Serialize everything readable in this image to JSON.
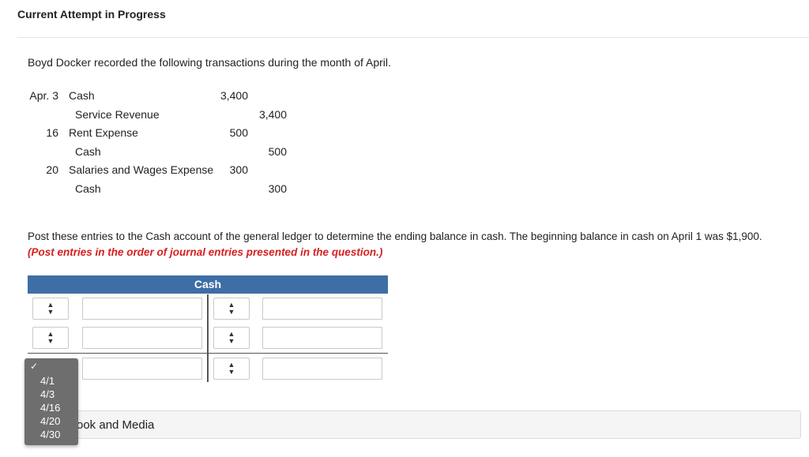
{
  "header": {
    "title": "Current Attempt in Progress"
  },
  "question": {
    "intro": "Boyd Docker recorded the following transactions during the month of April.",
    "journal": [
      {
        "date": "Apr. 3",
        "account": "Cash",
        "debit": "3,400",
        "credit": ""
      },
      {
        "date": "",
        "account": "Service Revenue",
        "debit": "",
        "credit": "3,400"
      },
      {
        "date": "16",
        "account": "Rent Expense",
        "debit": "500",
        "credit": ""
      },
      {
        "date": "",
        "account": "Cash",
        "debit": "",
        "credit": "500"
      },
      {
        "date": "20",
        "account": "Salaries and Wages Expense",
        "debit": "300",
        "credit": ""
      },
      {
        "date": "",
        "account": "Cash",
        "debit": "",
        "credit": "300"
      }
    ],
    "instruction": "Post these entries to the Cash account of the general ledger to determine the ending balance in cash. The beginning balance in cash on April 1 was $1,900.",
    "note": "(Post entries in the order of journal entries presented in the question.)"
  },
  "t_account": {
    "title": "Cash",
    "rows": [
      {
        "left_date": "",
        "left_amount": "",
        "right_date": "",
        "right_amount": ""
      },
      {
        "left_date": "",
        "left_amount": "",
        "right_date": "",
        "right_amount": ""
      },
      {
        "left_date": "",
        "left_amount": "",
        "right_date": "",
        "right_amount": ""
      }
    ]
  },
  "date_dropdown": {
    "check": "✓",
    "options": [
      "4/1",
      "4/3",
      "4/16",
      "4/20",
      "4/30"
    ]
  },
  "resources": {
    "label": "ook and Media"
  }
}
